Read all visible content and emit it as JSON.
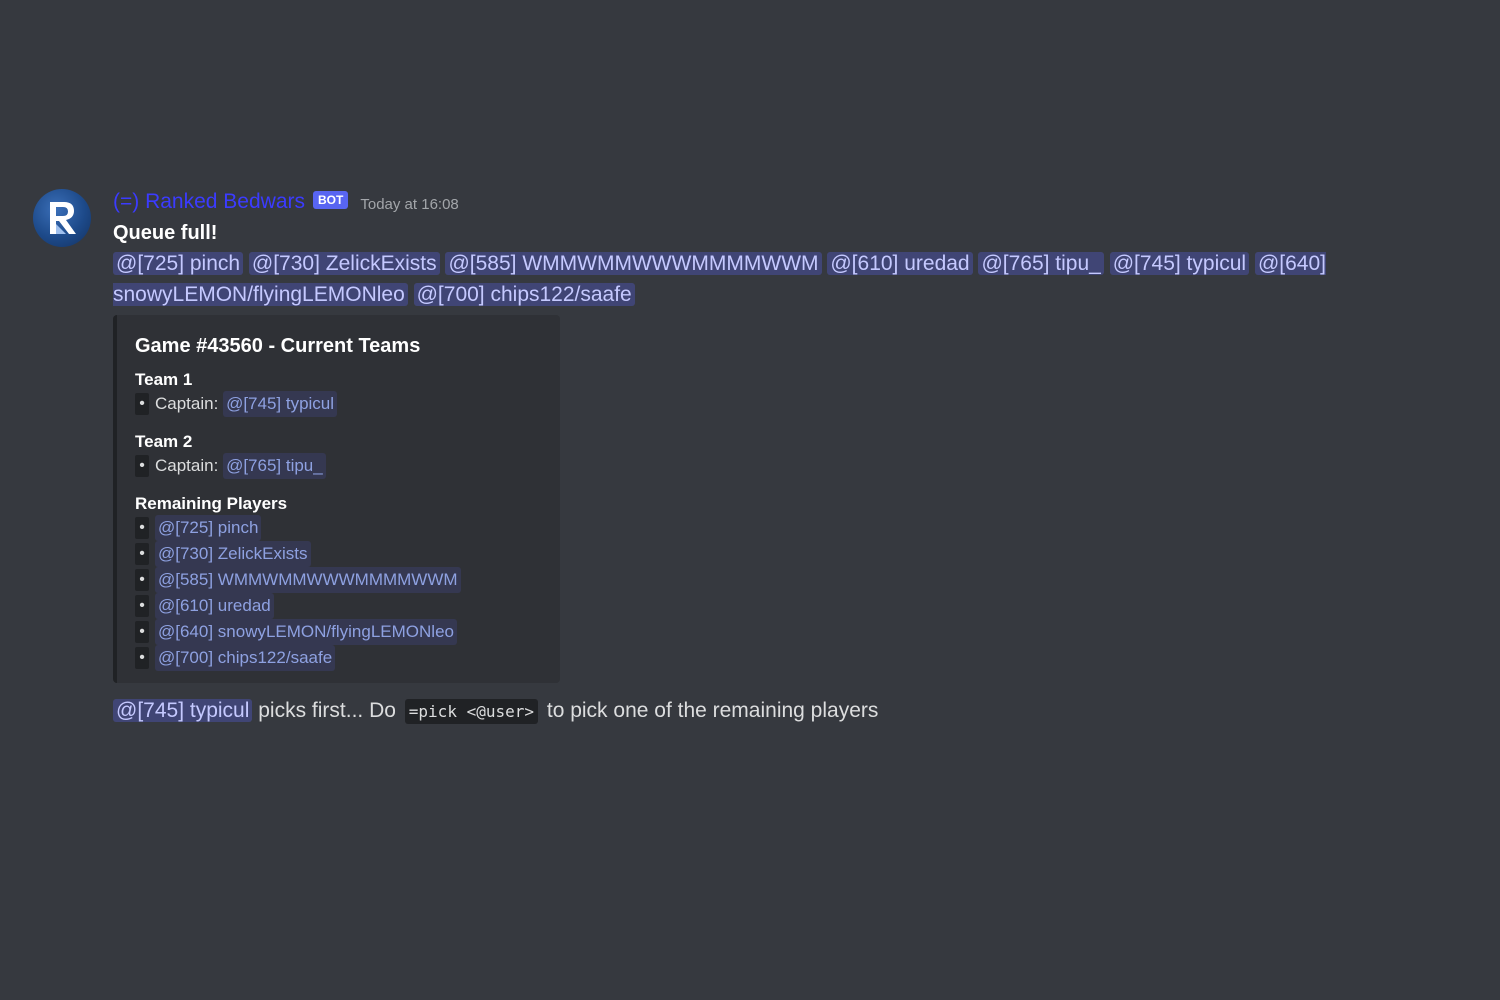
{
  "message": {
    "author": "(=) Ranked Bedwars",
    "bot_tag": "BOT",
    "timestamp": "Today at 16:08",
    "avatar_icon": "ranked-bedwars-logo-icon",
    "title": "Queue full!",
    "mentions": [
      "@[725] pinch",
      "@[730] ZelickExists",
      "@[585] WMMWMMWWWMMMMWWM",
      "@[610] uredad",
      "@[765] tipu_",
      "@[745] typicul",
      "@[640] snowyLEMON/flyingLEMONleo",
      "@[700] chips122/saafe"
    ]
  },
  "embed": {
    "title": "Game #43560 - Current Teams",
    "team1": {
      "name": "Team 1",
      "captain_label": "Captain:",
      "captain": "@[745] typicul"
    },
    "team2": {
      "name": "Team 2",
      "captain_label": "Captain:",
      "captain": "@[765] tipu_"
    },
    "remaining": {
      "name": "Remaining Players",
      "players": [
        "@[725] pinch",
        "@[730] ZelickExists",
        "@[585] WMMWMMWWWMMMMWWM",
        "@[610] uredad",
        "@[640] snowyLEMON/flyingLEMONleo",
        "@[700] chips122/saafe"
      ]
    },
    "bullet": "•"
  },
  "footer": {
    "mention": "@[745] typicul",
    "text_before_code": "picks first... Do",
    "code": "=pick <@user>",
    "text_after_code": "to pick one of the remaining players"
  },
  "colors": {
    "background": "#36393f",
    "embed_background": "#2f3136",
    "username": "#3b3bff",
    "bot_tag": "#5865f2",
    "mention_text": "#c5c9ff"
  }
}
